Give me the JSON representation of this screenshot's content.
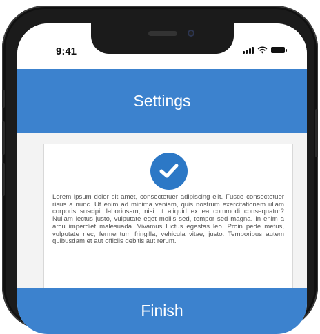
{
  "status_bar": {
    "time": "9:41",
    "icons": [
      "cellular-signal-icon",
      "wifi-icon",
      "battery-icon"
    ]
  },
  "header": {
    "title": "Settings"
  },
  "card": {
    "icon": "check-circle-icon",
    "body": "Lorem ipsum dolor sit amet, consectetuer adipiscing elit. Fusce consectetuer risus a nunc. Ut enim ad minima veniam, quis nostrum exercitationem ullam corporis suscipit laboriosam, nisi ut aliquid ex ea commodi consequatur? Nullam lectus justo, vulputate eget mollis sed, tempor sed magna. In enim a arcu imperdiet malesuada. Vivamus luctus egestas leo. Proin pede metus, vulputate nec, fermentum fringilla, vehicula vitae, justo. Temporibus autem quibusdam et aut officiis debitis aut rerum."
  },
  "footer": {
    "finish_label": "Finish"
  },
  "colors": {
    "accent": "#3c82ce",
    "check": "#2c78c6",
    "screen_bg": "#f3f3f3",
    "text": "#555555"
  }
}
